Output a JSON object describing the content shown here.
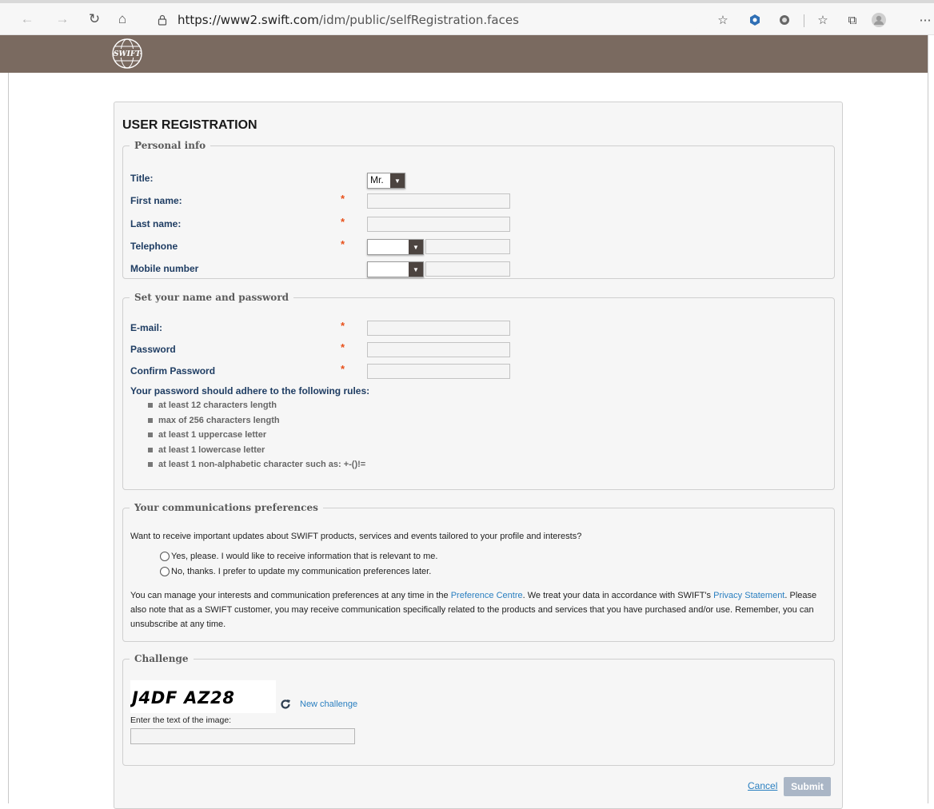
{
  "browser": {
    "url_host": "https://www2.swift.com",
    "url_path": "/idm/public/selfRegistration.faces"
  },
  "brand": {
    "logo_text": "SWIFT",
    "header_color": "#7a6a60",
    "accent_color": "#e8501a",
    "link_color": "#2a7fc0"
  },
  "page": {
    "title": "USER REGISTRATION"
  },
  "personal": {
    "legend": "Personal info",
    "title_label": "Title:",
    "title_value": "Mr.",
    "first_name_label": "First name:",
    "last_name_label": "Last name:",
    "telephone_label": "Telephone",
    "mobile_label": "Mobile number",
    "required_marker": "*"
  },
  "credentials": {
    "legend": "Set your name and password",
    "email_label": "E-mail:",
    "password_label": "Password",
    "confirm_label": "Confirm Password",
    "rules_title": "Your password should adhere to the following rules:",
    "rules": [
      "at least 12 characters length",
      "max of 256 characters length",
      "at least 1 uppercase letter",
      "at least 1 lowercase letter",
      "at least 1 non-alphabetic character such as: +-()!="
    ]
  },
  "comms": {
    "legend": "Your communications preferences",
    "question": "Want to receive important updates about SWIFT products, services and events tailored to your profile and interests?",
    "option_yes": "Yes, please. I would like to receive information that is relevant to me.",
    "option_no": "No, thanks. I prefer to update my communication preferences later.",
    "notice_1": "You can manage your interests and communication preferences at any time in the ",
    "preference_link": "Preference Centre",
    "notice_2": ". We treat your data in accordance with SWIFT's ",
    "privacy_link": "Privacy Statement",
    "notice_3": ". Please also note that as a SWIFT customer, you may receive communication specifically related to the products and services that you have purchased and/or use. Remember, you can unsubscribe at any time."
  },
  "challenge": {
    "legend": "Challenge",
    "captcha_text": "J4DF AZ28",
    "new_challenge": "New challenge",
    "instruction": "Enter the text of the image:"
  },
  "actions": {
    "cancel": "Cancel",
    "submit": "Submit"
  }
}
